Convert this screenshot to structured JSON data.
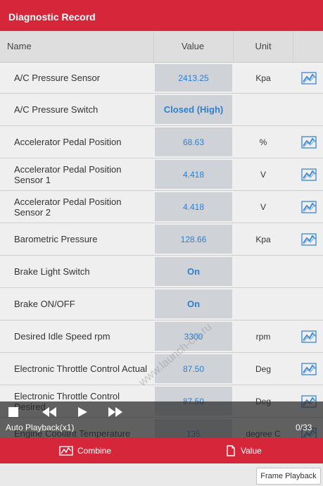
{
  "window": {
    "title": "Diagnostic Record"
  },
  "table": {
    "headers": {
      "name": "Name",
      "value": "Value",
      "unit": "Unit"
    },
    "rows": [
      {
        "name": "A/C Pressure Sensor",
        "value": "2413.25",
        "unit": "Kpa",
        "graph": true
      },
      {
        "name": "A/C Pressure Switch",
        "value": "Closed (High)",
        "unit": "",
        "graph": false
      },
      {
        "name": "Accelerator Pedal Position",
        "value": "68.63",
        "unit": "%",
        "graph": true
      },
      {
        "name": "Accelerator Pedal Position Sensor 1",
        "value": "4.418",
        "unit": "V",
        "graph": true
      },
      {
        "name": "Accelerator Pedal Position Sensor 2",
        "value": "4.418",
        "unit": "V",
        "graph": true
      },
      {
        "name": "Barometric Pressure",
        "value": "128.66",
        "unit": "Kpa",
        "graph": true
      },
      {
        "name": "Brake Light Switch",
        "value": "On",
        "unit": "",
        "graph": false
      },
      {
        "name": "Brake ON/OFF",
        "value": "On",
        "unit": "",
        "graph": false
      },
      {
        "name": "Desired Idle Speed rpm",
        "value": "3300",
        "unit": "rpm",
        "graph": true
      },
      {
        "name": "Electronic Throttle Control Actual",
        "value": "87.50",
        "unit": "Deg",
        "graph": true
      },
      {
        "name": "Electronic Throttle Control Desired",
        "value": "87.50",
        "unit": "Deg",
        "graph": true
      },
      {
        "name": "Engine Coolant Temperature",
        "value": "135",
        "unit": "degree C",
        "graph": true
      }
    ]
  },
  "playback": {
    "label": "Auto Playback(x1)",
    "counter": "0/33"
  },
  "toolbar": {
    "combine_label": "Combine",
    "value_label": "Value"
  },
  "footer": {
    "frame_playback_label": "Frame Playback"
  },
  "watermark": {
    "text": "www.launch-cis.ru"
  },
  "colors": {
    "accent": "#d6263a",
    "value_text": "#2a7fd6",
    "value_cell_bg": "#cfd3d8"
  }
}
